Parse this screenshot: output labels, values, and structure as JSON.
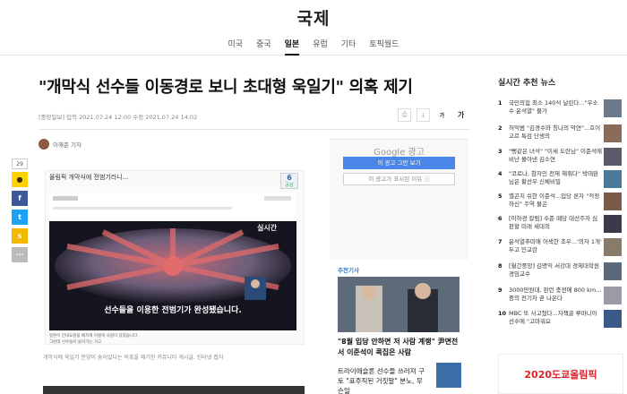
{
  "section": "국제",
  "nav": [
    "미국",
    "중국",
    "일본",
    "유럽",
    "기타",
    "토픽월드"
  ],
  "nav_active_index": 2,
  "article": {
    "headline": "\"개막식 선수들 이동경로 보니 초대형 욱일기\" 의혹 제기",
    "meta": "[중앙일보] 입력 2021.07.24 12:00 수정 2021.07.24 14:02",
    "author": "이해준 기자",
    "tools": {
      "font_small": "가",
      "font_large": "가"
    },
    "share_count": "29",
    "image_box_head": "올림픽 개막식에 전범기라니...",
    "image_badge_num": "6",
    "image_badge_label": "공감",
    "video_caption": "선수들을 이용한 전범기가 완성됐습니다.",
    "video_tag": "실시간",
    "caption_small_1": "일본이 안내요원을 배치해 이렇게 사람이 있었습니다.",
    "caption_small_2": "그런데 선수들이 들어가는 거고",
    "figure_caption": "개막식에 욱일기 문양이 숨어있다는 의혹을 제기한 커뮤니티 게시글. 인터넷 캡처"
  },
  "ad": {
    "title": "Google 광고",
    "stop_button": "이 광고 그만 보기",
    "why_button": "이 광고가 표시된 이유 ⓘ"
  },
  "recommended": {
    "label": "추천기사",
    "title": "\"8월 입당 안하면 저 사람 계랭\" 尹면전서 이준석이 콕집은 사람",
    "title2": "트라이애슬론 선수들 쓰러져 구토 \"표주직된 거짓말\" 분노, 무슨일"
  },
  "sidebar": {
    "title": "실시간 추천 뉴스",
    "items": [
      {
        "num": "1",
        "text": "국민의힘 최소 140석 날린다...\"우소수 윤석열\" 불가",
        "color": "#6a7a8a"
      },
      {
        "num": "2",
        "text": "허익범 \"김경수와 칭나의 악연\"...호이 고르 특검 단생의",
        "color": "#8a6a5a"
      },
      {
        "num": "3",
        "text": "\"뻥같은 녀석\" \"이세 도련님\" 이준석에 비난 몰아낸 김소연",
        "color": "#5a5a6a"
      },
      {
        "num": "4",
        "text": "\"코로나, 참자인 전재 해줘다\" 박태완 님은 황선우 신체비밀",
        "color": "#4a7a9a"
      },
      {
        "num": "5",
        "text": "옐곤치 쉬한 이준석...입당 론자 \"적정하신\" 주역 불곤",
        "color": "#7a5a4a"
      },
      {
        "num": "6",
        "text": "[이하경 칼럼] 수준 떼당 대선주자 심판할 미래 세대의",
        "color": "#3a3a4a"
      },
      {
        "num": "7",
        "text": "윤석열추미애 어색한 조우...'의자 1개' 두고 민교란",
        "color": "#8a7a6a"
      },
      {
        "num": "8",
        "text": "[월간중앙] 김명익 서강대 경제대학원 경임교수",
        "color": "#5a6a7a"
      },
      {
        "num": "9",
        "text": "3000만원대, 판런 충전에 800 km...중의 전기차 곧 나온다",
        "color": "#9a9aa8"
      },
      {
        "num": "10",
        "text": "MBC 또 사고쳤다...자책골 루마니아 선수에 \"고마워요",
        "color": "#3a5a8a"
      }
    ],
    "banner": "2020도쿄올림픽"
  }
}
